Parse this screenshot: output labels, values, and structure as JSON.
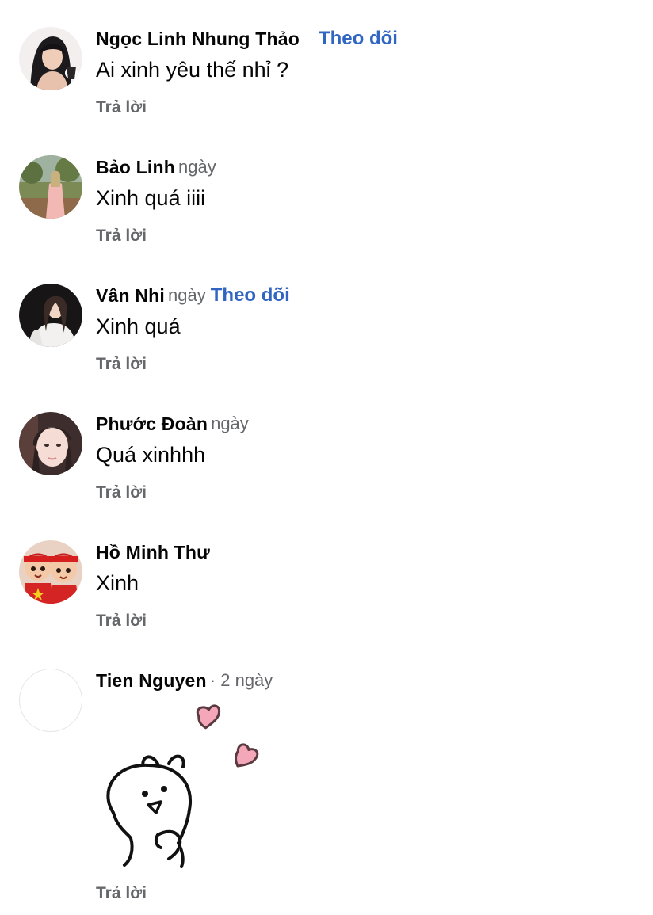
{
  "comments": [
    {
      "author": "Ngọc Linh Nhung Thảo",
      "meta": "",
      "follow": "Theo dõi",
      "text": "Ai xinh yêu thế nhỉ ?",
      "reply": "Trả lời"
    },
    {
      "author": "Bảo Linh",
      "meta": "ngày",
      "follow": "",
      "text": "Xinh quá iiii",
      "reply": "Trả lời"
    },
    {
      "author": "Vân Nhi",
      "meta": "ngày",
      "follow": "Theo dõi",
      "text": "Xinh quá",
      "reply": "Trả lời"
    },
    {
      "author": "Phước Đoàn",
      "meta": "ngày",
      "follow": "",
      "text": "Quá xinhhh",
      "reply": "Trả lời"
    },
    {
      "author": "Hồ Minh Thư",
      "meta": "",
      "follow": "",
      "text": "Xinh",
      "reply": "Trả lời"
    },
    {
      "author": "Tien Nguyen",
      "meta": "· 2 ngày",
      "follow": "",
      "text": "",
      "reply": "Trả lời",
      "sticker": "bunny-hearts-sticker"
    }
  ],
  "colors": {
    "follow_link": "#3165c2",
    "secondary_text": "#65676b",
    "heart_fill": "#f4a7b9",
    "heart_stroke": "#5a3a40"
  }
}
